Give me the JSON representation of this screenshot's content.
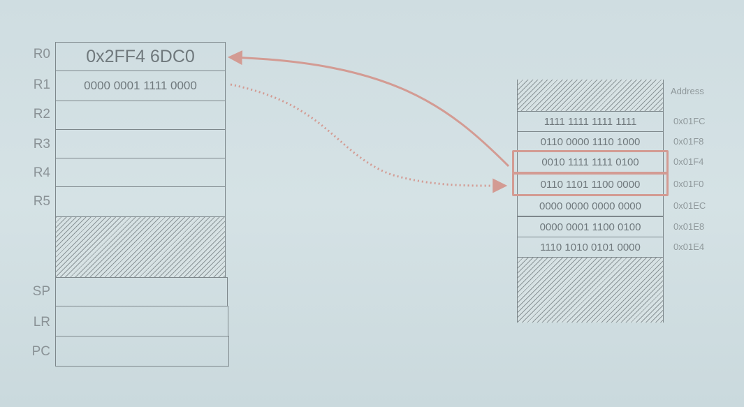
{
  "registers": [
    {
      "label": "R0",
      "value": "0x2FF4 6DC0"
    },
    {
      "label": "R1",
      "value": "0000 0001 1111 0000"
    },
    {
      "label": "R2",
      "value": ""
    },
    {
      "label": "R3",
      "value": ""
    },
    {
      "label": "R4",
      "value": ""
    },
    {
      "label": "R5",
      "value": ""
    },
    {
      "label": "SP",
      "value": ""
    },
    {
      "label": "LR",
      "value": ""
    },
    {
      "label": "PC",
      "value": ""
    }
  ],
  "memory": {
    "address_header": "Address",
    "cells": [
      {
        "value": "1111 1111 1111 1111",
        "address": "0x01FC"
      },
      {
        "value": "0110 0000 1110 1000",
        "address": "0x01F8"
      },
      {
        "value": "0010 1111 1111 0100",
        "address": "0x01F4"
      },
      {
        "value": "0110 1101 1100 0000",
        "address": "0x01F0"
      },
      {
        "value": "0000 0000 0000 0000",
        "address": "0x01EC"
      },
      {
        "value": "0000 0001 1100 0100",
        "address": "0x01E8"
      },
      {
        "value": "1110 1010 0101 0000",
        "address": "0x01E4"
      }
    ]
  },
  "colors": {
    "arrow": "#d39b93",
    "border": "#7d878b",
    "background": "#cfdde1"
  }
}
